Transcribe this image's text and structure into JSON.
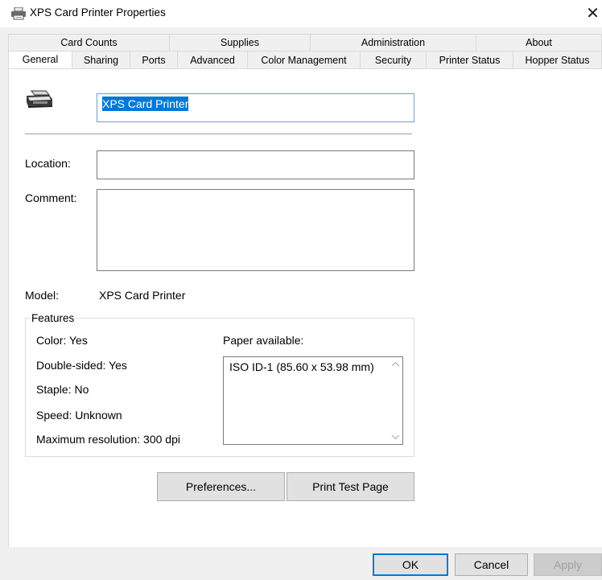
{
  "window": {
    "title": "XPS Card Printer Properties",
    "close_glyph": "✕"
  },
  "tabs": {
    "back_row": [
      "Card Counts",
      "Supplies",
      "Administration",
      "About"
    ],
    "front_row": [
      "General",
      "Sharing",
      "Ports",
      "Advanced",
      "Color Management",
      "Security",
      "Printer Status",
      "Hopper Status"
    ],
    "active": "General"
  },
  "general": {
    "printer_name": "XPS Card Printer",
    "location_label": "Location:",
    "location_value": "",
    "comment_label": "Comment:",
    "comment_value": "",
    "model_label": "Model:",
    "model_value": "XPS Card Printer"
  },
  "features": {
    "title": "Features",
    "color": "Color: Yes",
    "double_sided": "Double-sided: Yes",
    "staple": "Staple: No",
    "speed": "Speed: Unknown",
    "max_resolution": "Maximum resolution: 300 dpi",
    "paper_label": "Paper available:",
    "paper_items": [
      "ISO ID-1 (85.60 x 53.98 mm)"
    ]
  },
  "buttons": {
    "preferences": "Preferences...",
    "print_test_page": "Print Test Page",
    "ok": "OK",
    "cancel": "Cancel",
    "apply": "Apply"
  },
  "icons": {
    "title_icon": "printer-icon",
    "main_icon": "printer-icon",
    "scroll_up": "chevron-up-icon",
    "scroll_down": "chevron-down-icon"
  },
  "colors": {
    "accent": "#0078d7",
    "panel_bg": "#ffffff",
    "chrome_bg": "#f0f0f0"
  }
}
